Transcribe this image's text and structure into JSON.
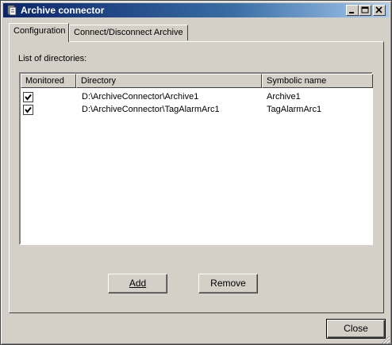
{
  "window": {
    "title": "Archive connector",
    "controls": {
      "minimize": "minimize",
      "maximize": "maximize",
      "close": "close"
    }
  },
  "tabs": [
    {
      "label": "Configuration",
      "active": true
    },
    {
      "label": "Connect/Disconnect Archive",
      "active": false
    }
  ],
  "configuration": {
    "list_caption": "List of directories:",
    "columns": [
      "Monitored",
      "Directory",
      "Symbolic name"
    ],
    "rows": [
      {
        "monitored": true,
        "directory": "D:\\ArchiveConnector\\Archive1",
        "symbolic_name": "Archive1"
      },
      {
        "monitored": true,
        "directory": "D:\\ArchiveConnector\\TagAlarmArc1",
        "symbolic_name": "TagAlarmArc1"
      }
    ],
    "add_button": "Add",
    "remove_button": "Remove"
  },
  "footer": {
    "close_button": "Close"
  },
  "colors": {
    "face": "#d4d0c8",
    "title_start": "#0a246a",
    "title_end": "#a6caf0"
  }
}
